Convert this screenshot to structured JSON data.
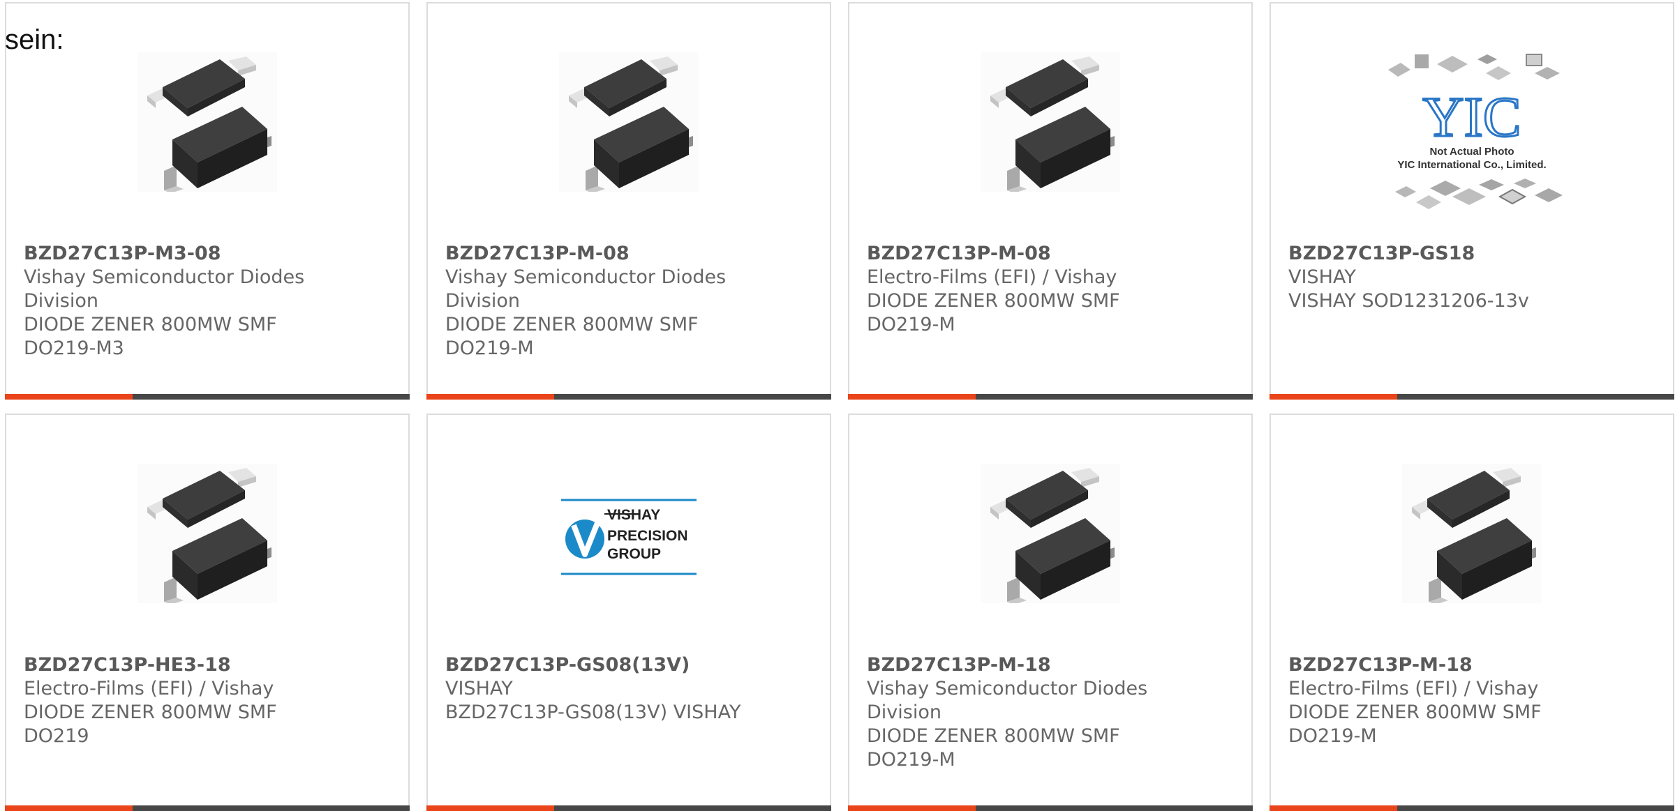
{
  "intro_text": "sein:",
  "accent_color": "#e9441a",
  "bar_color": "#474747",
  "cards": [
    {
      "image": "smf-diode-package",
      "part": "BZD27C13P-M3-08",
      "lines": [
        "Vishay Semiconductor Diodes",
        "Division",
        "DIODE ZENER 800MW SMF",
        "DO219-M3"
      ]
    },
    {
      "image": "smf-diode-package",
      "part": "BZD27C13P-M-08",
      "lines": [
        "Vishay Semiconductor Diodes",
        "Division",
        "DIODE ZENER 800MW SMF",
        "DO219-M"
      ]
    },
    {
      "image": "smf-diode-package",
      "part": "BZD27C13P-M-08",
      "lines": [
        "Electro-Films (EFI) / Vishay",
        "DIODE ZENER 800MW SMF",
        "DO219-M"
      ]
    },
    {
      "image": "yic-not-actual-photo",
      "image_text": {
        "logo": "YIC",
        "caption1": "Not Actual Photo",
        "caption2": "YIC International Co., Limited."
      },
      "part": "BZD27C13P-GS18",
      "lines": [
        "VISHAY",
        "VISHAY SOD1231206-13v"
      ]
    },
    {
      "image": "smf-diode-package",
      "part": "BZD27C13P-HE3-18",
      "lines": [
        "Electro-Films (EFI) / Vishay",
        "DIODE ZENER 800MW SMF",
        "DO219"
      ]
    },
    {
      "image": "vishay-precision-group-logo",
      "image_text": {
        "line1": "VISHAY",
        "line2": "PRECISION",
        "line3": "GROUP"
      },
      "part": "BZD27C13P-GS08(13V)",
      "lines": [
        "VISHAY",
        "BZD27C13P-GS08(13V) VISHAY"
      ]
    },
    {
      "image": "smf-diode-package",
      "part": "BZD27C13P-M-18",
      "lines": [
        "Vishay Semiconductor Diodes",
        "Division",
        "DIODE ZENER 800MW SMF",
        "DO219-M"
      ]
    },
    {
      "image": "smf-diode-package",
      "part": "BZD27C13P-M-18",
      "lines": [
        "Electro-Films (EFI) / Vishay",
        "DIODE ZENER 800MW SMF",
        "DO219-M"
      ]
    }
  ]
}
